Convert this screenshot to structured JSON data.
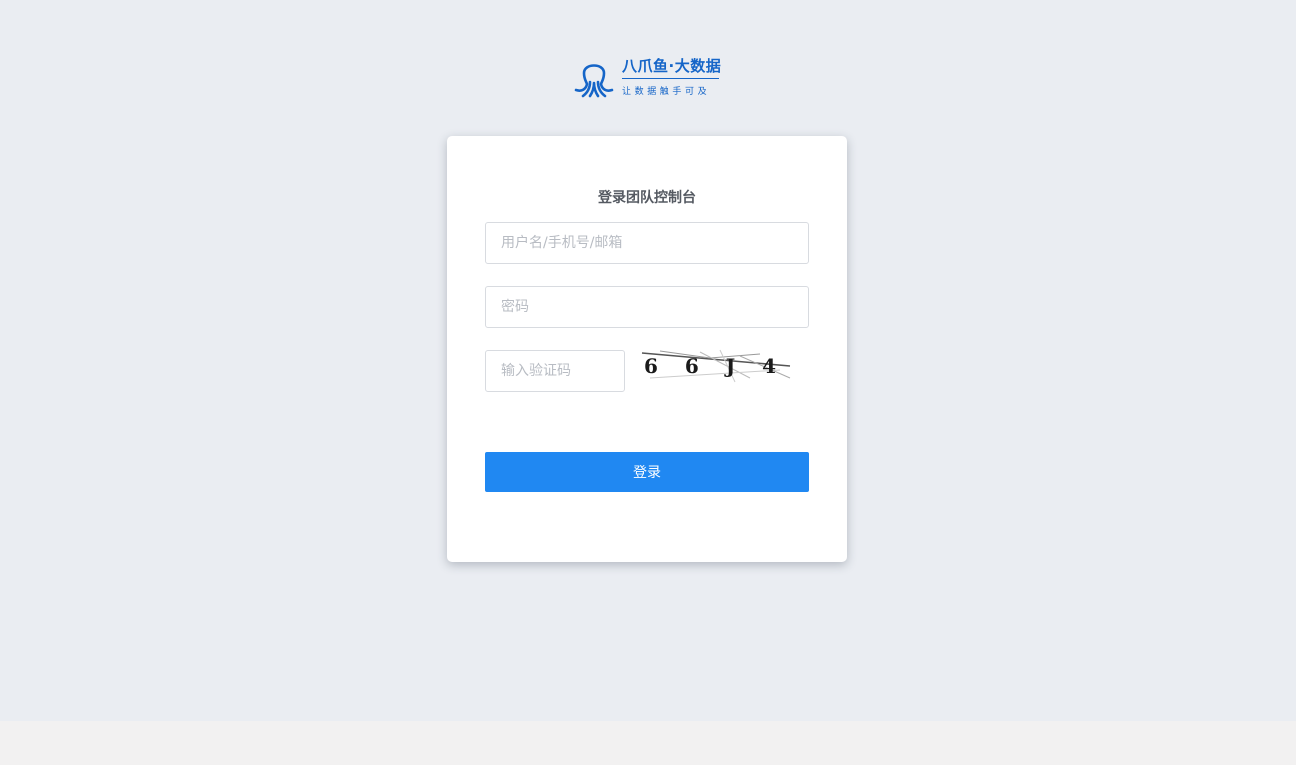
{
  "brand": {
    "name": "八爪鱼·大数据",
    "slogan": "让数据触手可及",
    "color": "#1565c8"
  },
  "login": {
    "title": "登录团队控制台",
    "username_placeholder": "用户名/手机号/邮箱",
    "password_placeholder": "密码",
    "captcha_placeholder": "输入验证码",
    "captcha_code": "6 6 J 4",
    "submit_label": "登录",
    "accent": "#2088f2"
  }
}
